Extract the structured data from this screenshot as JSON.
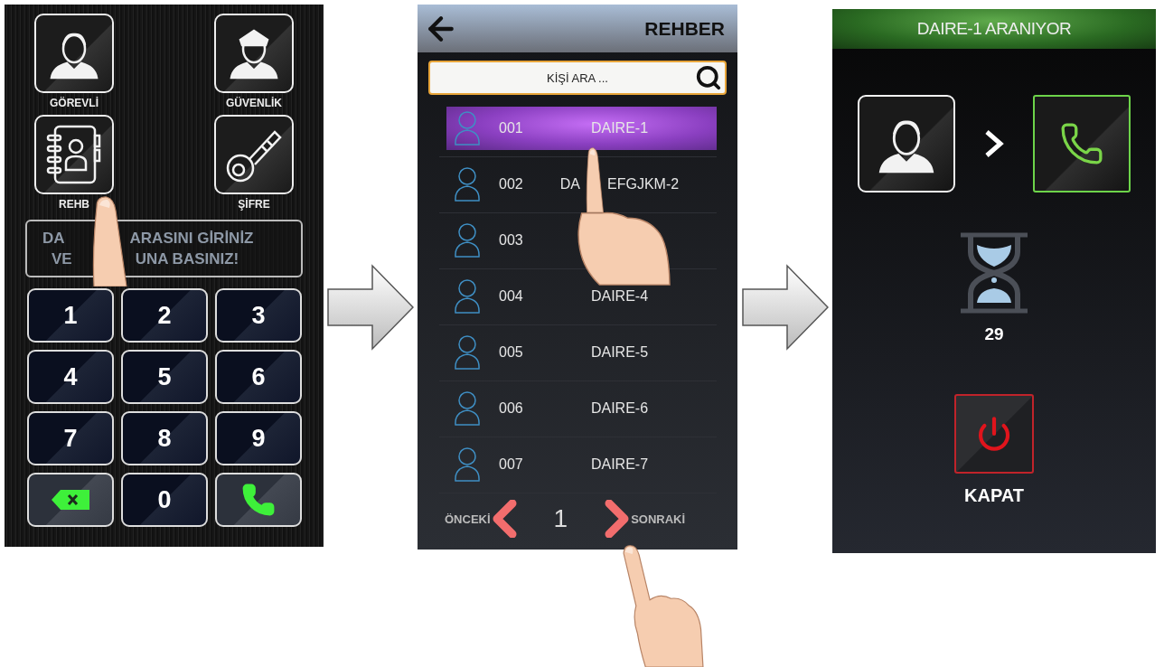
{
  "keypad_screen": {
    "tiles": [
      {
        "kind": "staff",
        "label": "GÖREVLİ"
      },
      {
        "kind": "guard",
        "label": "GÜVENLİK"
      },
      {
        "kind": "directory",
        "label": "REHB"
      },
      {
        "kind": "password",
        "label": "ŞİFRE"
      }
    ],
    "message": {
      "lines": [
        [
          "DA",
          "ARASINI GİRİNİZ"
        ],
        [
          "VE",
          "UNA BASINIZ!"
        ]
      ]
    },
    "keys": [
      {
        "kind": "digit",
        "label": "1"
      },
      {
        "kind": "digit",
        "label": "2"
      },
      {
        "kind": "digit",
        "label": "3"
      },
      {
        "kind": "digit",
        "label": "4"
      },
      {
        "kind": "digit",
        "label": "5"
      },
      {
        "kind": "digit",
        "label": "6"
      },
      {
        "kind": "digit",
        "label": "7"
      },
      {
        "kind": "digit",
        "label": "8"
      },
      {
        "kind": "digit",
        "label": "9"
      },
      {
        "kind": "backspace"
      },
      {
        "kind": "digit",
        "label": "0"
      },
      {
        "kind": "call"
      }
    ]
  },
  "directory_screen": {
    "title": "REHBER",
    "search": {
      "placeholder": "KİŞİ ARA ..."
    },
    "rows": [
      {
        "number": "001",
        "name_parts": [
          "DAIRE-1"
        ],
        "selected": true
      },
      {
        "number": "002",
        "name_parts": [
          "DA",
          "EFGJKM-2"
        ],
        "selected": false
      },
      {
        "number": "003",
        "selected": false
      },
      {
        "number": "004",
        "name_parts": [
          "DAIRE-4"
        ],
        "selected": false
      },
      {
        "number": "005",
        "name_parts": [
          "DAIRE-5"
        ],
        "selected": false
      },
      {
        "number": "006",
        "name_parts": [
          "DAIRE-6"
        ],
        "selected": false
      },
      {
        "number": "007",
        "name_parts": [
          "DAIRE-7"
        ],
        "selected": false
      }
    ],
    "pagination": {
      "previous": "ÖNCEKİ",
      "page": "1",
      "next": "SONRAKİ"
    }
  },
  "calling_screen": {
    "title": "DAIRE-1 ARANIYOR",
    "countdown": "29",
    "hangup_label": "KAPAT"
  }
}
